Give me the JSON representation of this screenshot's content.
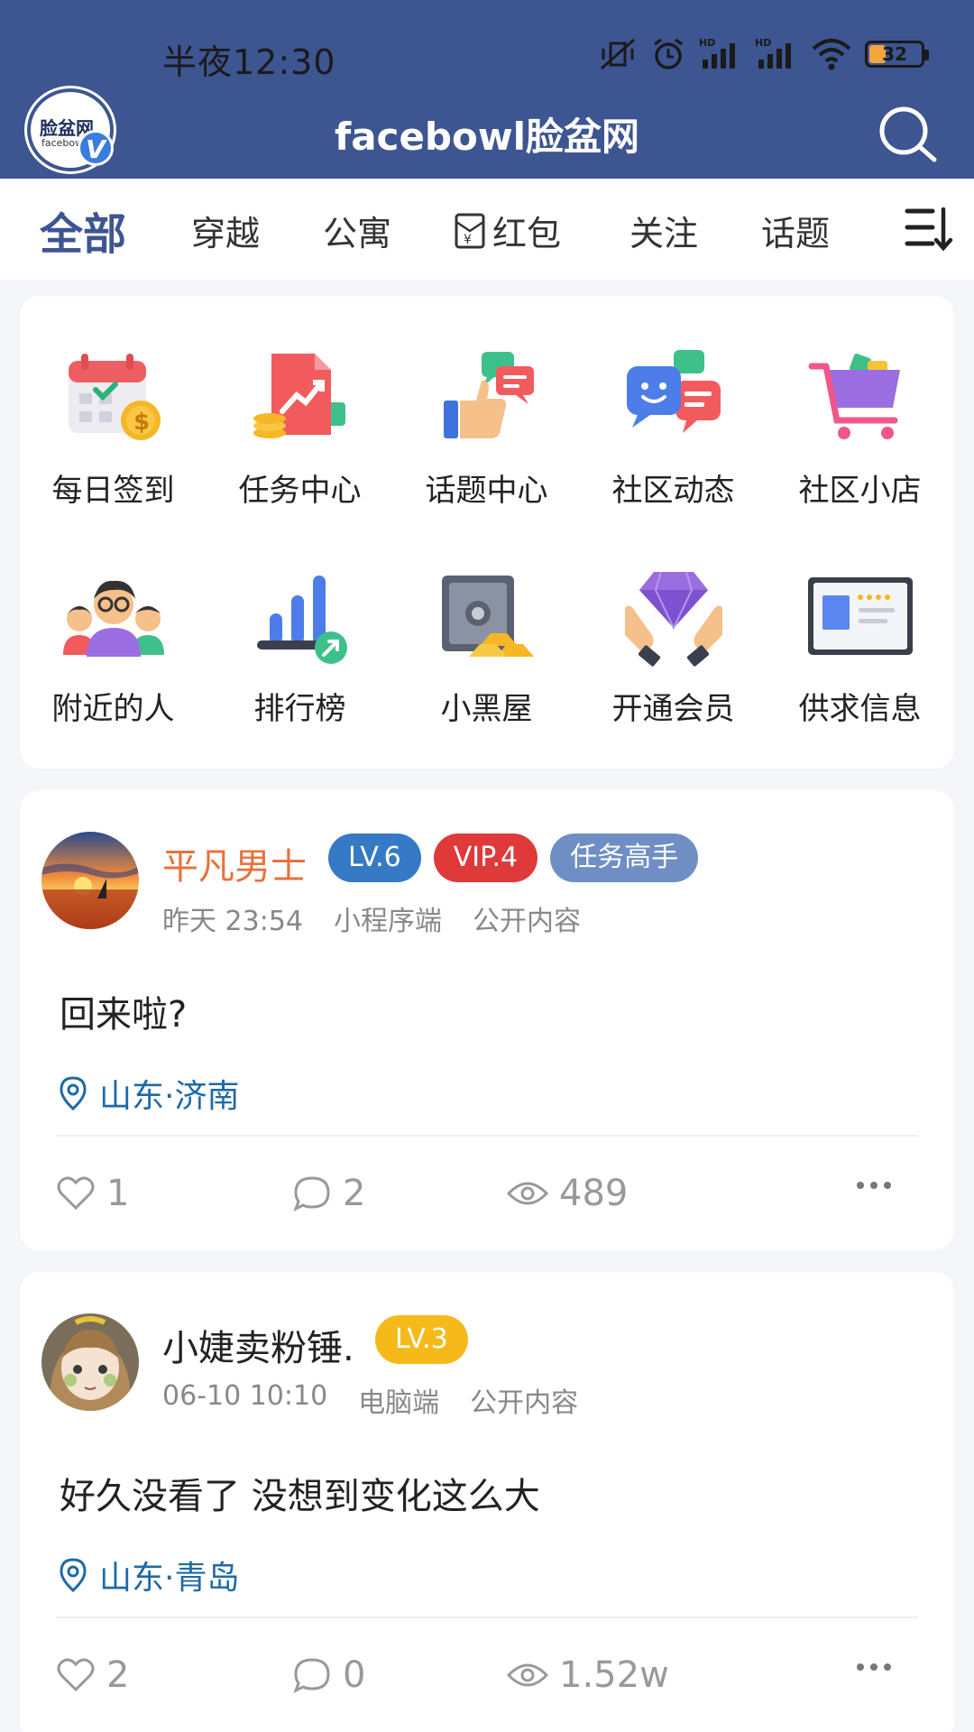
{
  "status_bar": {
    "time": "半夜12:30",
    "battery": "32"
  },
  "header": {
    "logo_text": "脸盆网",
    "logo_sub": "facebowl",
    "logo_badge": "V",
    "title": "facebowl脸盆网"
  },
  "tabs": [
    {
      "label": "全部",
      "active": true
    },
    {
      "label": "穿越"
    },
    {
      "label": "公寓"
    },
    {
      "label": "红包"
    },
    {
      "label": "关注"
    },
    {
      "label": "话题"
    }
  ],
  "grid": [
    {
      "label": "每日签到",
      "icon": "calendar-checkin-icon"
    },
    {
      "label": "任务中心",
      "icon": "task-chart-icon"
    },
    {
      "label": "话题中心",
      "icon": "thumbs-up-chat-icon"
    },
    {
      "label": "社区动态",
      "icon": "chat-bubbles-icon"
    },
    {
      "label": "社区小店",
      "icon": "shopping-cart-icon"
    },
    {
      "label": "附近的人",
      "icon": "people-group-icon"
    },
    {
      "label": "排行榜",
      "icon": "bar-ranking-icon"
    },
    {
      "label": "小黑屋",
      "icon": "safe-gold-icon"
    },
    {
      "label": "开通会员",
      "icon": "diamond-hands-icon"
    },
    {
      "label": "供求信息",
      "icon": "info-board-icon"
    }
  ],
  "posts": [
    {
      "username": "平凡男士",
      "username_color": "#e5733d",
      "badges": [
        {
          "text": "LV.6",
          "color": "#3679c4"
        },
        {
          "text": "VIP.4",
          "color": "#e0393a"
        },
        {
          "text": "任务高手",
          "color": "#6e8ec4"
        }
      ],
      "time": "昨天 23:54",
      "client": "小程序端",
      "visibility": "公开内容",
      "content": "回来啦?",
      "location": "山东·济南",
      "likes": "1",
      "comments": "2",
      "views": "489"
    },
    {
      "username": "小婕卖粉锤.",
      "username_color": "#222222",
      "badges": [
        {
          "text": "LV.3",
          "color": "#f6b91a"
        }
      ],
      "time": "06-10 10:10",
      "client": "电脑端",
      "visibility": "公开内容",
      "content": "好久没看了 没想到变化这么大",
      "location": "山东·青岛",
      "likes": "2",
      "comments": "0",
      "views": "1.52w"
    }
  ],
  "colors": {
    "header_bg": "#3d5591",
    "active_tab": "#3d5591",
    "location": "#1e6aa7"
  }
}
